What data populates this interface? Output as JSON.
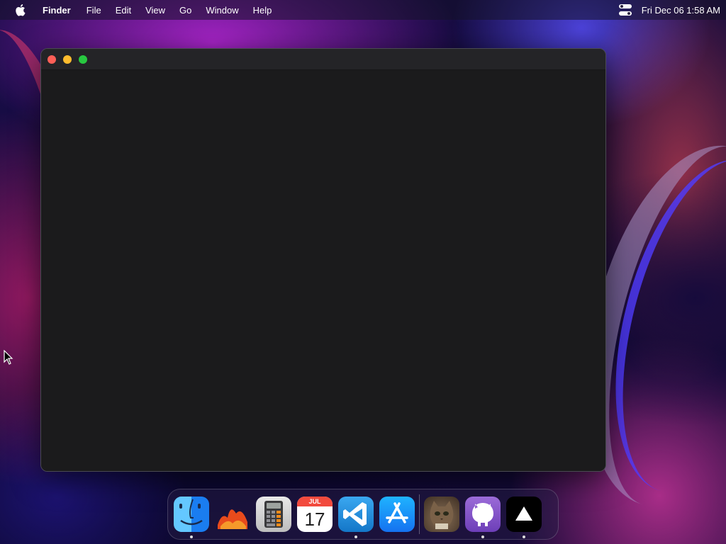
{
  "menubar": {
    "app_name": "Finder",
    "menus": [
      "File",
      "Edit",
      "View",
      "Go",
      "Window",
      "Help"
    ],
    "clock": "Fri Dec 06  1:58 AM"
  },
  "window": {
    "controls": [
      "close",
      "minimize",
      "maximize"
    ],
    "colors": {
      "close": "#fe5f57",
      "minimize": "#febc2e",
      "maximize": "#28c840"
    }
  },
  "dock": {
    "calendar": {
      "month": "JUL",
      "day": "17"
    },
    "items": [
      {
        "name": "finder-icon",
        "running": true
      },
      {
        "name": "photos-app-icon",
        "running": false
      },
      {
        "name": "calculator-icon",
        "running": false
      },
      {
        "name": "calendar-icon",
        "running": false
      },
      {
        "name": "vscode-icon",
        "running": true
      },
      {
        "name": "app-store-icon",
        "running": false
      },
      {
        "name": "cat-photo-icon",
        "running": false
      },
      {
        "name": "github-desktop-icon",
        "running": true
      },
      {
        "name": "vercel-triangle-icon",
        "running": true
      }
    ]
  }
}
